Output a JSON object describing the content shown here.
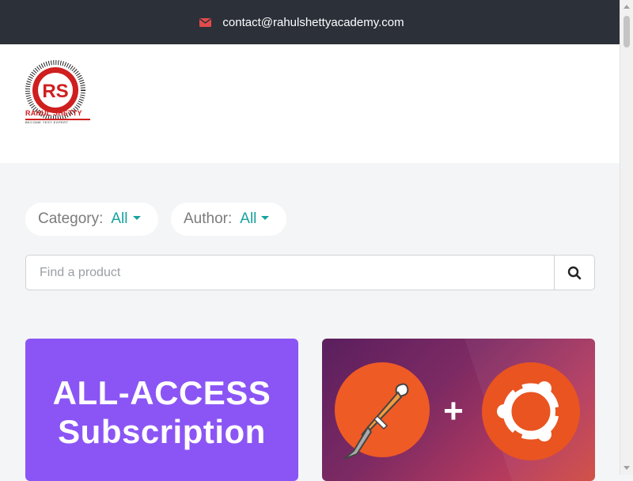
{
  "topbar": {
    "email": "contact@rahulshettyacademy.com",
    "icon": "envelope-icon",
    "icon_color": "#e24b4b"
  },
  "logo": {
    "initials": "RS",
    "name": "RAHUL SHETTY",
    "tagline": "BECOME TEST EXPERT"
  },
  "filters": {
    "category_label": "Category:",
    "category_value": "All",
    "author_label": "Author:",
    "author_value": "All"
  },
  "search": {
    "placeholder": "Find a product",
    "value": "",
    "icon": "search-icon"
  },
  "products": [
    {
      "line1": "ALL-ACCESS",
      "line2": "Subscription",
      "bg_color": "#8b55f5"
    },
    {
      "plus": "+",
      "icons": [
        "postman-logo",
        "ubuntu-logo"
      ]
    }
  ],
  "colors": {
    "accent": "#17a2a0",
    "topbar_bg": "#2b3039",
    "brand_red": "#cf1f1f"
  }
}
